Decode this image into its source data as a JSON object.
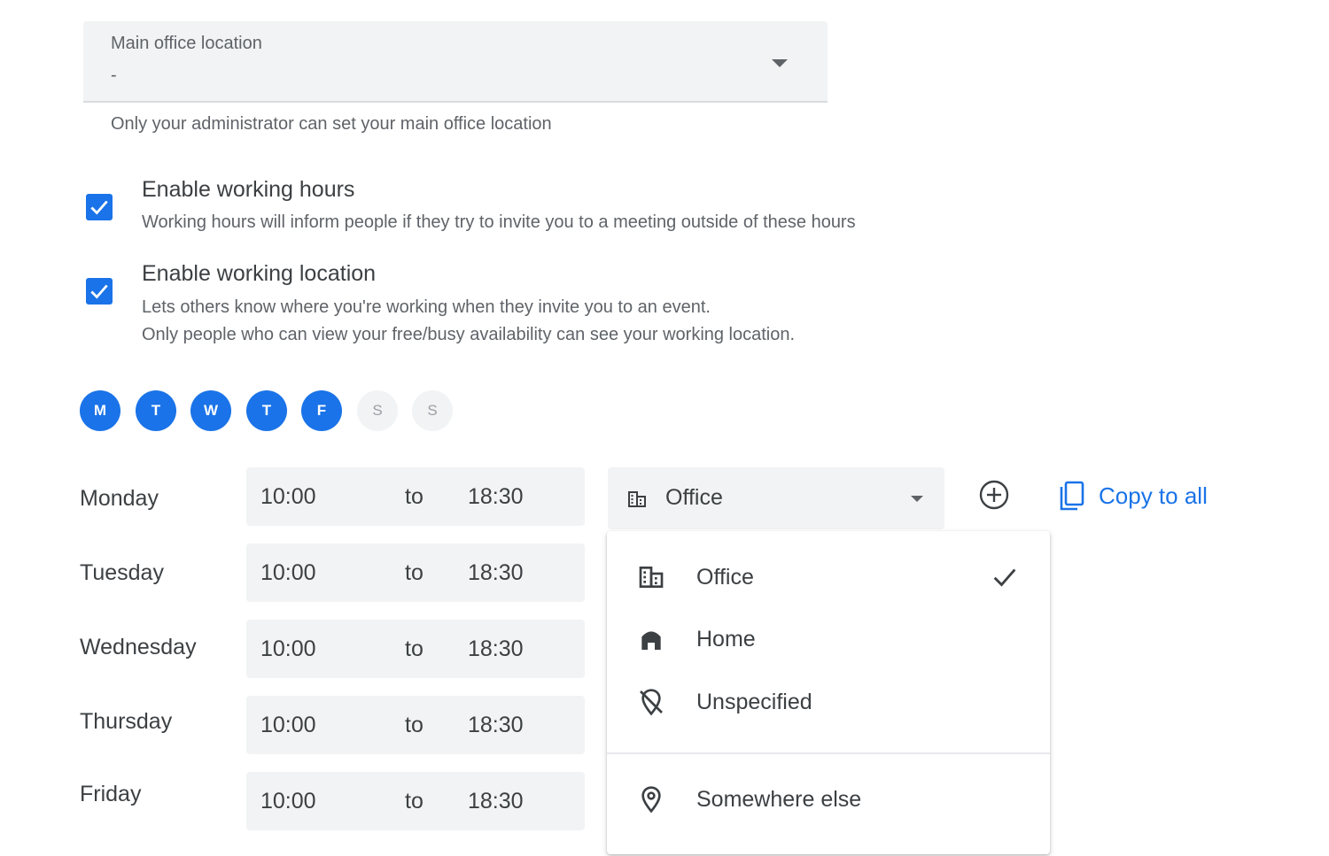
{
  "main_office": {
    "label": "Main office location",
    "value": "-",
    "helper": "Only your administrator can set your main office location"
  },
  "options": [
    {
      "title": "Enable working hours",
      "checked": true,
      "desc_lines": [
        "Working hours will inform people if they try to invite you to a meeting outside of these hours"
      ]
    },
    {
      "title": "Enable working location",
      "checked": true,
      "desc_lines": [
        "Lets others know where you're working when they invite you to an event.",
        "Only people who can view your free/busy availability can see your working location."
      ]
    }
  ],
  "days": [
    {
      "letter": "M",
      "selected": true
    },
    {
      "letter": "T",
      "selected": true
    },
    {
      "letter": "W",
      "selected": true
    },
    {
      "letter": "T",
      "selected": true
    },
    {
      "letter": "F",
      "selected": true
    },
    {
      "letter": "S",
      "selected": false
    },
    {
      "letter": "S",
      "selected": false
    }
  ],
  "schedule": [
    {
      "day": "Monday",
      "start": "10:00",
      "sep": "to",
      "end": "18:30"
    },
    {
      "day": "Tuesday",
      "start": "10:00",
      "sep": "to",
      "end": "18:30"
    },
    {
      "day": "Wednesday",
      "start": "10:00",
      "sep": "to",
      "end": "18:30"
    },
    {
      "day": "Thursday",
      "start": "10:00",
      "sep": "to",
      "end": "18:30"
    },
    {
      "day": "Friday",
      "start": "10:00",
      "sep": "to",
      "end": "18:30"
    }
  ],
  "location_select": {
    "value": "Office",
    "icon": "building-icon"
  },
  "copy_to_all": "Copy to all",
  "menu": {
    "items": [
      {
        "label": "Office",
        "icon": "building-icon",
        "selected": true
      },
      {
        "label": "Home",
        "icon": "home-icon",
        "selected": false
      },
      {
        "label": "Unspecified",
        "icon": "location-off-icon",
        "selected": false
      },
      {
        "label": "Somewhere else",
        "icon": "location-pin-icon",
        "selected": false
      }
    ]
  },
  "colors": {
    "accent": "#1a73e8",
    "field_bg": "#f1f3f4",
    "text": "#3c4043",
    "muted": "#5f6368"
  }
}
